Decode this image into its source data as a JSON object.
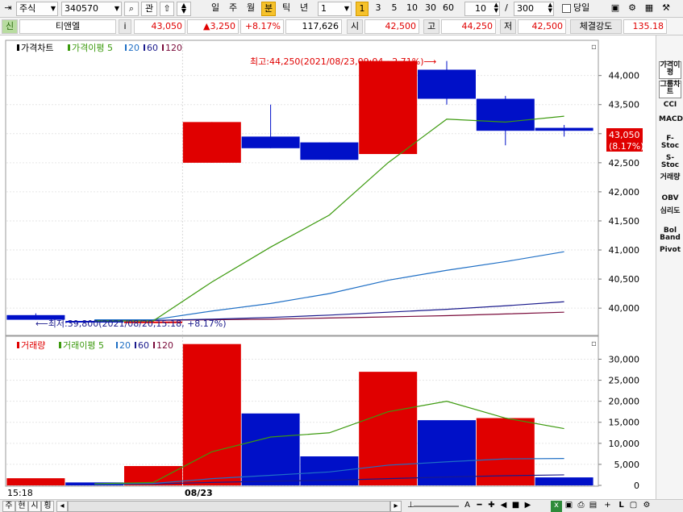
{
  "toolbar": {
    "market": "주식",
    "code": "340570",
    "btn_gwan": "관",
    "periods": [
      "일",
      "주",
      "월",
      "분",
      "틱",
      "년"
    ],
    "selected_period": "분",
    "interval_value": "1",
    "interval_sel": "1",
    "interval_options": [
      "3",
      "5",
      "10",
      "30",
      "60"
    ],
    "count_value": "10",
    "slash": "/",
    "total_value": "300",
    "today_label": "당일"
  },
  "infobar": {
    "prefix": "신",
    "name": "티앤엘",
    "i_label": "i",
    "price": "43,050",
    "change": "▲3,250",
    "change_pct": "+8.17%",
    "volume": "117,626",
    "open_label": "시",
    "open": "42,500",
    "high_label": "고",
    "high": "44,250",
    "low_label": "저",
    "low": "42,500",
    "strength_label": "체결강도",
    "strength": "135.18"
  },
  "right_panel": [
    "가격이평",
    "그룹차트",
    "CCI",
    "MACD",
    "F-Stoc",
    "S-Stoc",
    "거래량",
    "OBV",
    "심리도",
    "Bol Band",
    "Pivot"
  ],
  "bottom": {
    "time_label": "15:18",
    "date_label": "08/23",
    "tabs": [
      "주",
      "현",
      "시",
      "횡"
    ]
  },
  "chart_data": [
    {
      "type": "candlestick",
      "legend": [
        "가격차트",
        "가격이평 5",
        "20",
        "60",
        "120"
      ],
      "series_colors": {
        "ma5": "#3c9a0e",
        "ma20": "#1f6fc5",
        "ma60": "#1a1a8c",
        "ma120": "#7a0b3a"
      },
      "candles": [
        {
          "open": 39880,
          "high": 39910,
          "low": 39800,
          "close": 39800
        },
        {
          "open": 39780,
          "high": 39790,
          "low": 39760,
          "close": 39760
        },
        {
          "open": 39770,
          "high": 39780,
          "low": 39760,
          "close": 39770
        },
        {
          "open": 42500,
          "high": 43200,
          "low": 42500,
          "close": 43200
        },
        {
          "open": 42950,
          "high": 43500,
          "low": 42750,
          "close": 42750
        },
        {
          "open": 42850,
          "high": 42850,
          "low": 42550,
          "close": 42550
        },
        {
          "open": 42650,
          "high": 44250,
          "low": 42650,
          "close": 44250
        },
        {
          "open": 44100,
          "high": 44250,
          "low": 43500,
          "close": 43600
        },
        {
          "open": 43600,
          "high": 43650,
          "low": 42800,
          "close": 43050
        },
        {
          "open": 43100,
          "high": 43150,
          "low": 42950,
          "close": 43050
        }
      ],
      "ma5": [
        null,
        39780,
        39780,
        40450,
        41050,
        41600,
        42500,
        43250,
        43200,
        43300
      ],
      "ma20": [
        null,
        39800,
        39800,
        39950,
        40080,
        40250,
        40480,
        40650,
        40800,
        40970
      ],
      "ma60": [
        null,
        39790,
        39790,
        39810,
        39840,
        39880,
        39930,
        39980,
        40040,
        40110
      ],
      "ma120": [
        null,
        39790,
        39790,
        39800,
        39810,
        39830,
        39850,
        39870,
        39900,
        39930
      ],
      "y_ticks": [
        "44,000",
        "43,500",
        "43,000",
        "42,500",
        "42,000",
        "41,500",
        "41,000",
        "40,500",
        "40,000"
      ],
      "ylim": [
        39600,
        44550
      ],
      "high_annotation": "최고:44,250(2021/08/23,09:04, -2.71%)⟶",
      "low_annotation": "⟵최저:39,800(2021/08/20,15:18, +8.17%)",
      "last_price_label": "43,050",
      "last_pct_label": "(8.17%)"
    },
    {
      "type": "bar",
      "legend": [
        "거래량",
        "거래이평 5",
        "20",
        "60",
        "120"
      ],
      "volumes": [
        1700,
        700,
        4600,
        33600,
        17100,
        6900,
        27000,
        15500,
        16000,
        1900
      ],
      "directions": [
        "up",
        "down",
        "up",
        "up",
        "down",
        "down",
        "up",
        "down",
        "up",
        "down"
      ],
      "ma5": [
        null,
        400,
        700,
        8000,
        11500,
        12500,
        17500,
        20000,
        16000,
        13500
      ],
      "ma20": [
        null,
        300,
        450,
        1600,
        2400,
        3200,
        4800,
        5600,
        6300,
        6400
      ],
      "ma60": [
        null,
        250,
        350,
        700,
        1000,
        1200,
        1600,
        2000,
        2300,
        2500
      ],
      "y_ticks": [
        "30,000",
        "25,000",
        "20,000",
        "15,000",
        "10,000",
        "5,000",
        "0"
      ],
      "ylim": [
        0,
        34500
      ]
    }
  ]
}
